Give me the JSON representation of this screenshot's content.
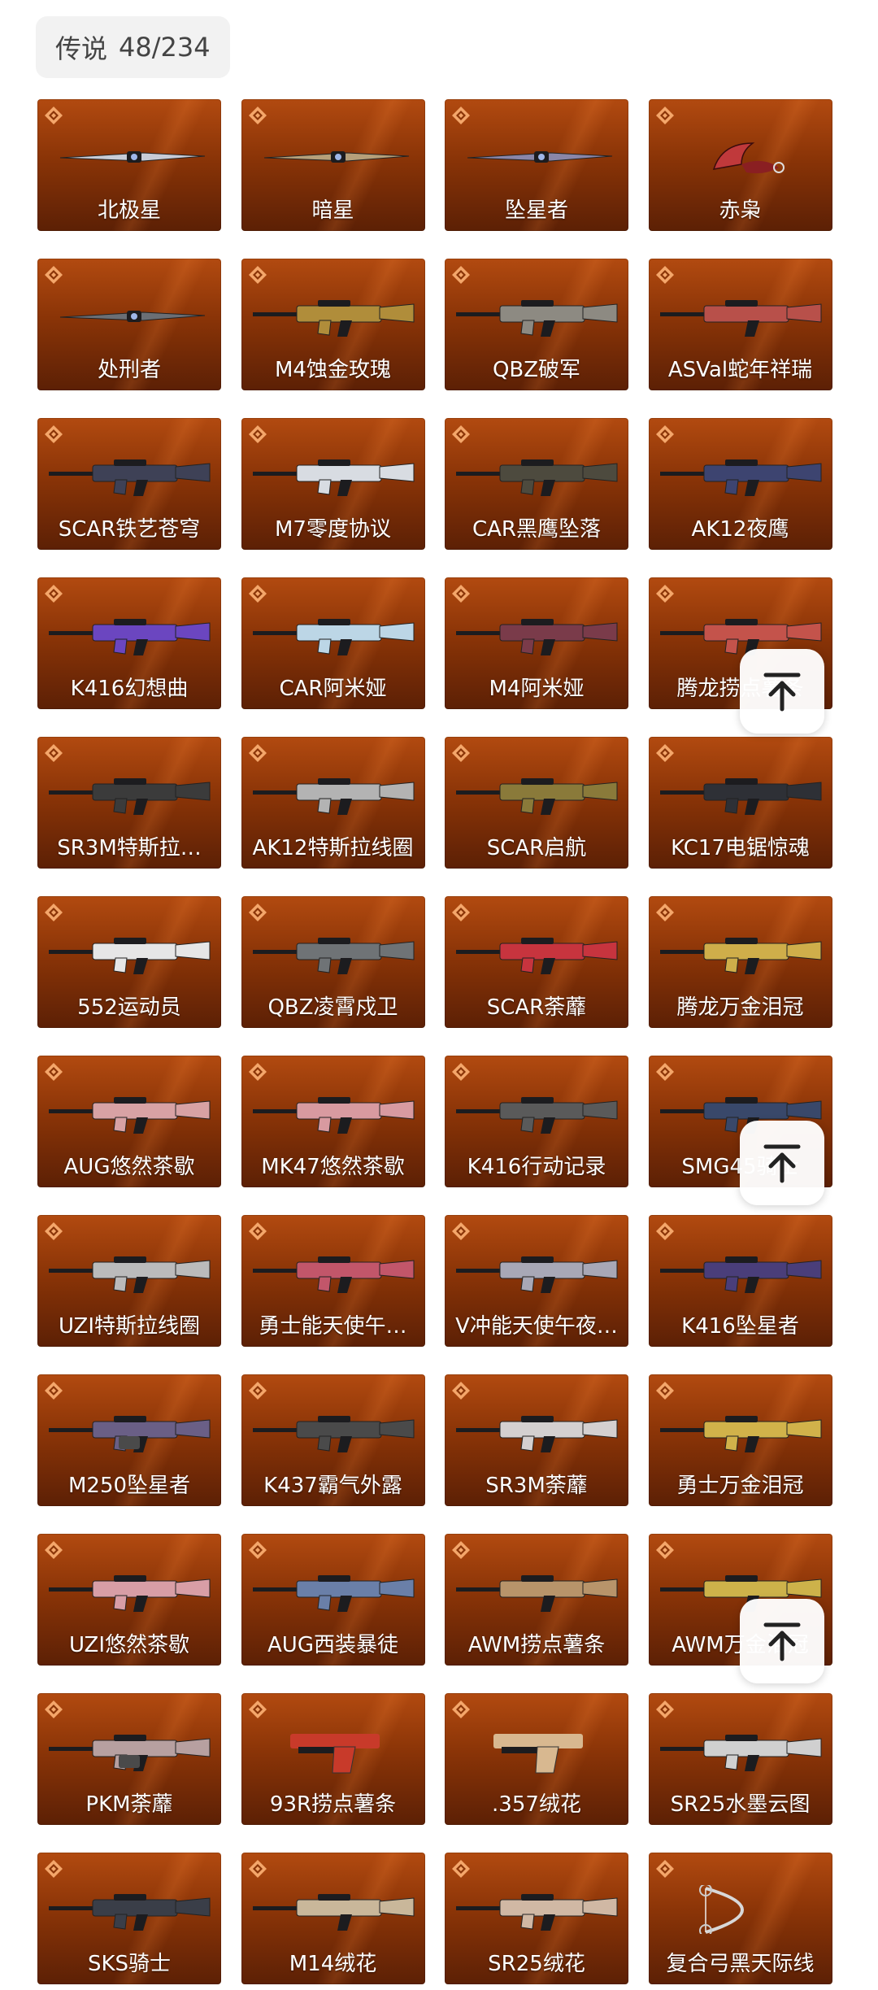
{
  "header": {
    "category": "传说",
    "count": "48/234"
  },
  "items": [
    {
      "name": "北极星",
      "type": "knife",
      "color": "#c8ccd6"
    },
    {
      "name": "暗星",
      "type": "knife",
      "color": "#b6a07a"
    },
    {
      "name": "坠星者",
      "type": "knife",
      "color": "#8a86a8"
    },
    {
      "name": "赤枭",
      "type": "karambit",
      "color": "#c0393b"
    },
    {
      "name": "处刑者",
      "type": "knife",
      "color": "#6b6f75"
    },
    {
      "name": "M4蚀金玫瑰",
      "type": "rifle",
      "color": "#b08d3a"
    },
    {
      "name": "QBZ破军",
      "type": "rifle",
      "color": "#8d8a82"
    },
    {
      "name": "ASVal蛇年祥瑞",
      "type": "sniper",
      "color": "#b8504a"
    },
    {
      "name": "SCAR铁艺苍穹",
      "type": "rifle",
      "color": "#3e4156"
    },
    {
      "name": "M7零度协议",
      "type": "rifle",
      "color": "#d8dce2"
    },
    {
      "name": "CAR黑鹰坠落",
      "type": "rifle",
      "color": "#4d4a3e"
    },
    {
      "name": "AK12夜鹰",
      "type": "rifle",
      "color": "#3d4470"
    },
    {
      "name": "K416幻想曲",
      "type": "rifle",
      "color": "#6b46c0"
    },
    {
      "name": "CAR阿米娅",
      "type": "smg",
      "color": "#bcd6e6"
    },
    {
      "name": "M4阿米娅",
      "type": "rifle",
      "color": "#7a3b4a"
    },
    {
      "name": "腾龙捞点薯条",
      "type": "rifle",
      "color": "#c4534b"
    },
    {
      "name": "SR3M特斯拉…",
      "type": "rifle",
      "color": "#3b3b3b"
    },
    {
      "name": "AK12特斯拉线圈",
      "type": "rifle",
      "color": "#b3b3b3"
    },
    {
      "name": "SCAR启航",
      "type": "rifle",
      "color": "#8a7a3a"
    },
    {
      "name": "KC17电锯惊魂",
      "type": "rifle",
      "color": "#2e3036"
    },
    {
      "name": "552运动员",
      "type": "rifle",
      "color": "#e6e6e6"
    },
    {
      "name": "QBZ凌霄戍卫",
      "type": "rifle",
      "color": "#6f7376"
    },
    {
      "name": "SCAR荼蘼",
      "type": "rifle",
      "color": "#c7343e"
    },
    {
      "name": "腾龙万金泪冠",
      "type": "rifle",
      "color": "#cfae4a"
    },
    {
      "name": "AUG悠然茶歇",
      "type": "smg",
      "color": "#d8a2a4"
    },
    {
      "name": "MK47悠然茶歇",
      "type": "rifle",
      "color": "#d89aa0"
    },
    {
      "name": "K416行动记录",
      "type": "rifle",
      "color": "#5a5a5a"
    },
    {
      "name": "SMG45骑士",
      "type": "smg",
      "color": "#39486a"
    },
    {
      "name": "UZI特斯拉线圈",
      "type": "smg",
      "color": "#bbbbbb"
    },
    {
      "name": "勇士能天使午…",
      "type": "rifle",
      "color": "#c2566a"
    },
    {
      "name": "V冲能天使午夜…",
      "type": "rifle",
      "color": "#a8a8b6"
    },
    {
      "name": "K416坠星者",
      "type": "rifle",
      "color": "#4a3e7a"
    },
    {
      "name": "M250坠星者",
      "type": "lmg",
      "color": "#6a5f86"
    },
    {
      "name": "K437霸气外露",
      "type": "rifle",
      "color": "#4a4a4a"
    },
    {
      "name": "SR3M荼蘼",
      "type": "rifle",
      "color": "#d4d0d0"
    },
    {
      "name": "勇士万金泪冠",
      "type": "rifle",
      "color": "#d1b24a"
    },
    {
      "name": "UZI悠然茶歇",
      "type": "smg",
      "color": "#d89ea6"
    },
    {
      "name": "AUG西装暴徒",
      "type": "rifle",
      "color": "#6a7fa8"
    },
    {
      "name": "AWM捞点薯条",
      "type": "sniper",
      "color": "#b8946a"
    },
    {
      "name": "AWM万金泪冠",
      "type": "sniper",
      "color": "#cdb24a"
    },
    {
      "name": "PKM荼蘼",
      "type": "lmg",
      "color": "#b7a0a0"
    },
    {
      "name": "93R捞点薯条",
      "type": "pistol",
      "color": "#c83a2a"
    },
    {
      "name": ".357绒花",
      "type": "pistol",
      "color": "#d8b890"
    },
    {
      "name": "SR25水墨云图",
      "type": "rifle",
      "color": "#d0d0d0"
    },
    {
      "name": "SKS骑士",
      "type": "rifle",
      "color": "#3a3e48"
    },
    {
      "name": "M14绒花",
      "type": "sniper",
      "color": "#c9b79a"
    },
    {
      "name": "SR25绒花",
      "type": "rifle",
      "color": "#d0b8a4"
    },
    {
      "name": "复合弓黑天际线",
      "type": "bow",
      "color": "#d8d8d8"
    }
  ],
  "back_to_top": {
    "icon": "arrow-up-to-top-icon"
  }
}
